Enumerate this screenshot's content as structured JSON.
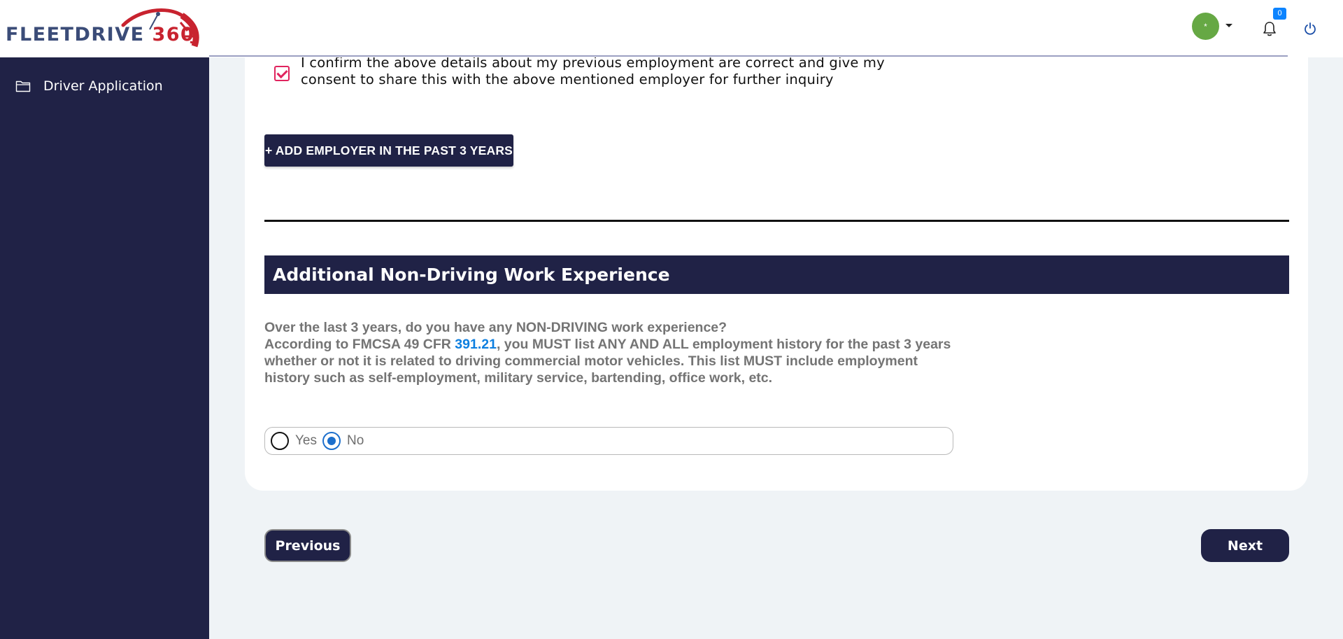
{
  "header": {
    "logo_text_main": "FLEETDRIVE ",
    "logo_text_accent": "360",
    "avatar_initial": "*",
    "notification_count": "0"
  },
  "sidebar": {
    "items": [
      {
        "label": "Driver Application",
        "icon": "folder-icon"
      }
    ]
  },
  "form": {
    "consent_text": "I confirm the above details about my previous employment are correct and give my consent to share this with the above mentioned employer for further inquiry",
    "consent_checked": true,
    "add_employer_label": "+ ADD EMPLOYER IN THE PAST 3 YEARS",
    "section_title": "Additional Non-Driving Work Experience",
    "question_line1": "Over the last 3 years, do you have any NON-DRIVING work experience?",
    "question_line2_pre": "According to FMCSA 49 CFR ",
    "question_link": "391.21",
    "question_line2_post": ", you MUST list ANY AND ALL employment history for the past 3 years whether or not it is related to driving commercial motor vehicles. This list MUST include employment history such as self-employment, military service, bartending, office work, etc.",
    "options": [
      {
        "label": "Yes",
        "selected": false
      },
      {
        "label": "No",
        "selected": true
      }
    ]
  },
  "nav": {
    "previous_label": "Previous",
    "next_label": "Next"
  },
  "colors": {
    "sidebar_bg": "#202246",
    "accent_red": "#c8232f",
    "link_blue": "#0d7fe0",
    "avatar_green": "#66a844",
    "checkbox_pink": "#e0245e"
  }
}
